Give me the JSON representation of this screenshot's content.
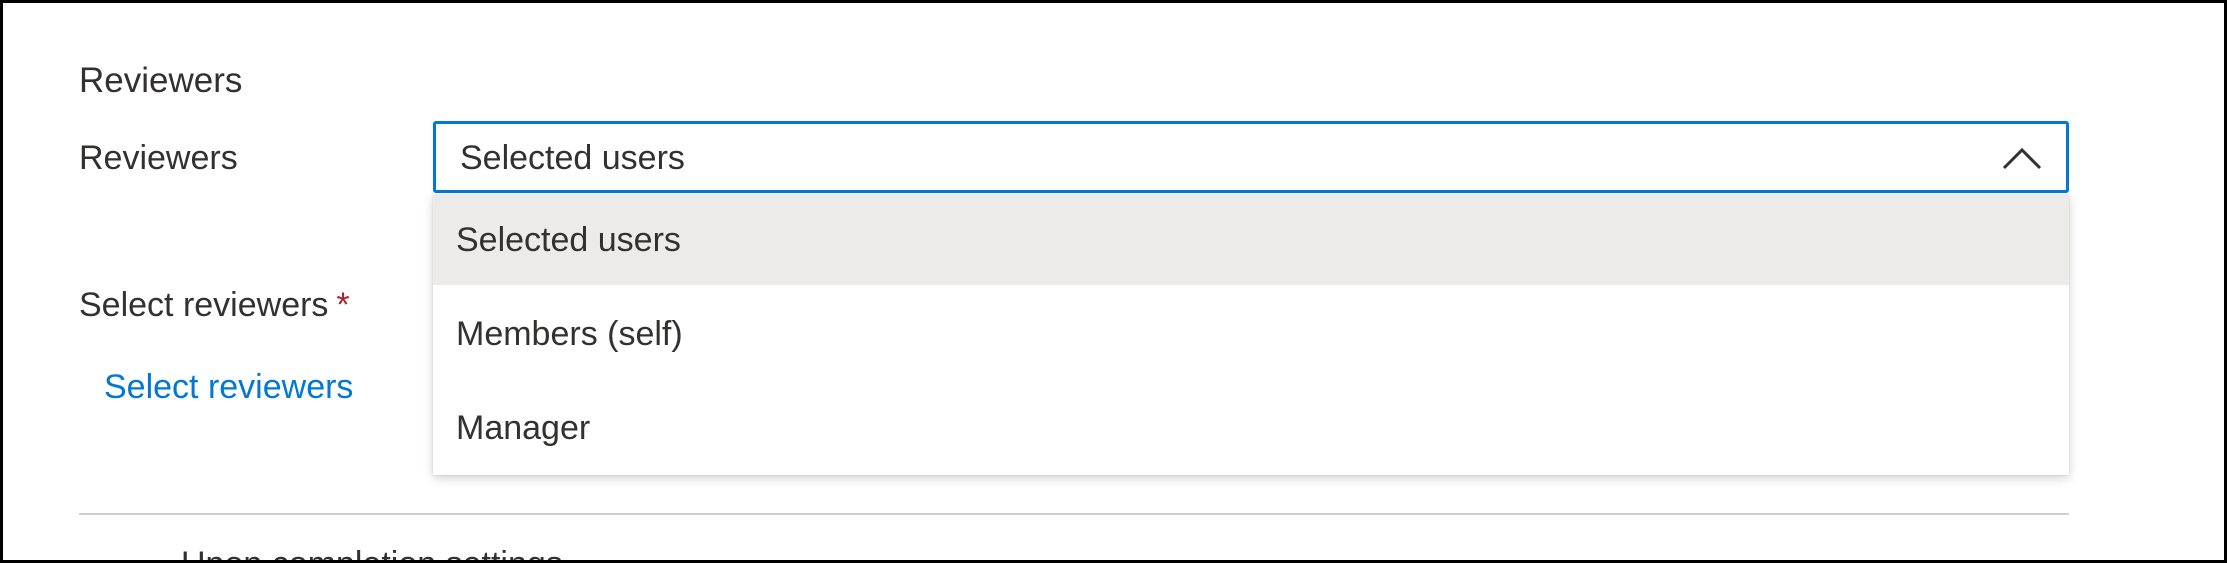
{
  "section": {
    "title": "Reviewers"
  },
  "reviewers_field": {
    "label": "Reviewers",
    "selected_value": "Selected users",
    "expanded": true,
    "options": [
      {
        "label": "Selected users",
        "selected": true
      },
      {
        "label": "Members (self)",
        "selected": false
      },
      {
        "label": "Manager",
        "selected": false
      }
    ]
  },
  "select_reviewers": {
    "label": "Select reviewers",
    "required_marker": "*",
    "link_text": "Select reviewers"
  },
  "below_fold": {
    "partial_text": "Upon completion settings"
  },
  "icons": {
    "dropdown_toggle": "chevron-up-icon"
  },
  "colors": {
    "accent": "#0078d4",
    "required": "#a4262c",
    "selected_option_bg": "#edebe9",
    "text": "#323130",
    "divider": "#d2d0ce"
  }
}
